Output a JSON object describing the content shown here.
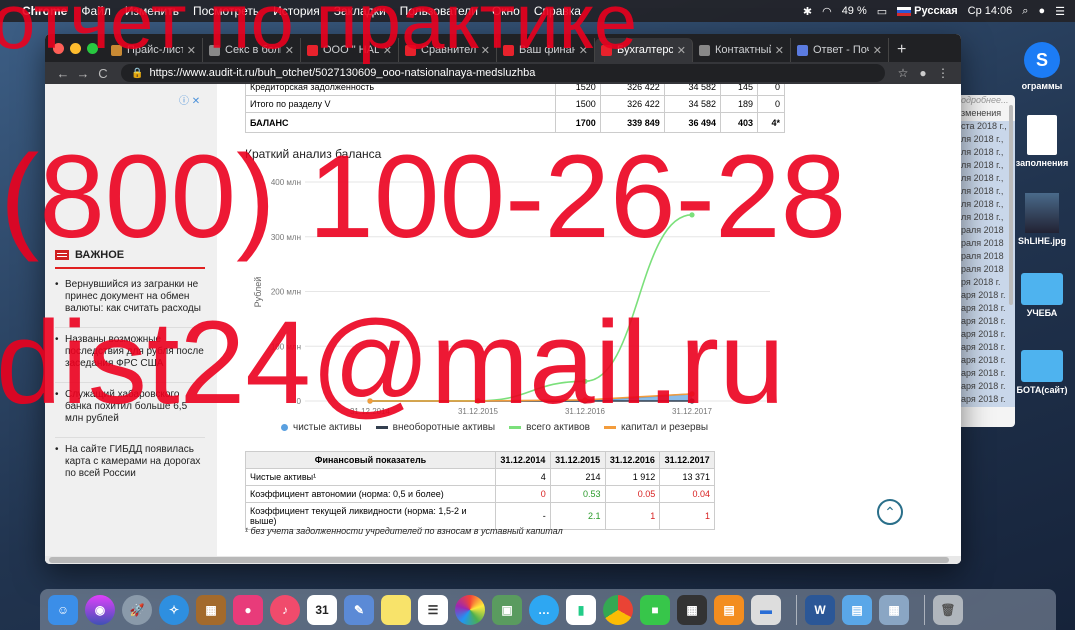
{
  "menubar": {
    "items": [
      "Chrome",
      "Файл",
      "Изменить",
      "Посмотреть",
      "История",
      "Закладки",
      "Пользователи",
      "Окно",
      "Справка"
    ],
    "battery": "49 %",
    "input_source": "Русская",
    "clock": "Ср 14:06"
  },
  "browser": {
    "tabs": [
      {
        "label": "Прайс-лист",
        "color": "#c98a34"
      },
      {
        "label": "Секс в боль",
        "color": "#888888"
      },
      {
        "label": "ООО \" НАЦ",
        "color": "#e8222c"
      },
      {
        "label": "Сравнитель",
        "color": "#e8222c"
      },
      {
        "label": "Ваш финанс",
        "color": "#e8222c"
      },
      {
        "label": "Бухгалтерс",
        "color": "#e8222c"
      },
      {
        "label": "Контактный",
        "color": "#888888"
      },
      {
        "label": "Ответ - Поч",
        "color": "#5b7be0"
      }
    ],
    "new_tab": "+",
    "url": "https://www.audit-it.ru/buh_otchet/5027130609_ooo-natsionalnaya-medsluzhba"
  },
  "sidebar": {
    "important_title": "ВАЖНОЕ",
    "news": [
      "Вернувшийся из загранки не принес документ на обмен валюты: как считать расходы",
      "Названы возможные последствия для рубля после заседания ФРС США",
      "Служащий хабаровского банка похитил больше 6,5 млн рублей",
      "На сайте ГИБДД появилась карта с камерами на дорогах по всей России"
    ]
  },
  "balance_table": {
    "rows": [
      {
        "label": "Кредиторская задолженность",
        "code": "1520",
        "v1": "326 422",
        "v2": "34 582",
        "v3": "145",
        "v4": "0"
      },
      {
        "label": "Итого по разделу V",
        "code": "1500",
        "v1": "326 422",
        "v2": "34 582",
        "v3": "189",
        "v4": "0"
      },
      {
        "label": "БАЛАНС",
        "code": "1700",
        "v1": "339 849",
        "v2": "36 494",
        "v3": "403",
        "v4": "4*"
      }
    ]
  },
  "chart_title": "Краткий анализ баланса",
  "chart_data": {
    "type": "line",
    "ylabel": "Рублей",
    "y_ticks": [
      "0",
      "100 млн",
      "200 млн",
      "300 млн",
      "400 млн"
    ],
    "ylim": [
      0,
      400
    ],
    "x": [
      "31.12.2014",
      "31.12.2015",
      "31.12.2016",
      "31.12.2017"
    ],
    "series": [
      {
        "name": "чистые активы",
        "color": "#5aa0e0",
        "values": [
          0,
          0,
          0,
          13
        ]
      },
      {
        "name": "внеоборотные активы",
        "color": "#333f4f",
        "values": [
          0,
          0,
          0,
          0
        ]
      },
      {
        "name": "всего активов",
        "color": "#7be07b",
        "values": [
          0,
          0.4,
          36,
          340
        ]
      },
      {
        "name": "капитал и резервы",
        "color": "#f39c3c",
        "values": [
          0,
          0,
          2,
          13
        ]
      }
    ]
  },
  "fin_table": {
    "headers": [
      "Финансовый показатель",
      "31.12.2014",
      "31.12.2015",
      "31.12.2016",
      "31.12.2017"
    ],
    "rows": [
      {
        "label": "Чистые активы¹",
        "c1": "4",
        "c2": "214",
        "c3": "1 912",
        "c4": "13 371"
      },
      {
        "label": "Коэффициент автономии (норма: 0,5 и более)",
        "c1": "0",
        "c2": "0.53",
        "c3": "0.05",
        "c4": "0.04"
      },
      {
        "label": "Коэффициент текущей ликвидности (норма: 1,5-2 и выше)",
        "c1": "-",
        "c2": "2.1",
        "c3": "1",
        "c4": "1"
      }
    ],
    "footnote": "¹ без учета задолженности учредителей по взносам в уставный капитал"
  },
  "bg_window": {
    "items": [
      "одробнее...",
      "зменения",
      "ста 2018 г.,",
      "ля 2018 г.,",
      "ля 2018 г.,",
      "ля 2018 г.,",
      "ля 2018 г.,",
      "ля 2018 г.,",
      "ля 2018 г.,",
      "ля 2018 г.,",
      "раля 2018",
      "раля 2018",
      "раля 2018",
      "раля 2018",
      "ря 2018 г.",
      "аря 2018 г.",
      "аря 2018 г.",
      "аря 2018 г.",
      "аря 2018 г.",
      "аря 2018 г.",
      "аря 2018 г.",
      "аря 2018 г.",
      "аря 2018 г.",
      "аря 2018 г."
    ]
  },
  "desktop_icons": [
    "ограммы",
    "заполнения",
    "ShLIHE.jpg",
    "УЧЕБА",
    "БОТА(сайт)"
  ],
  "watermark": {
    "line1": "отчет по практике",
    "line2": "(800) 100-26-28",
    "line3": "dist24@mail.ru"
  }
}
